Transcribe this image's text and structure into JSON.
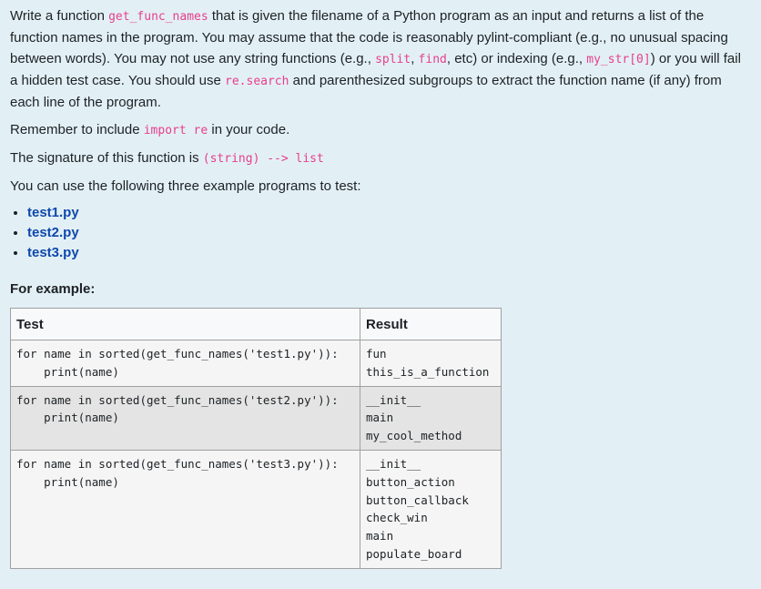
{
  "question": {
    "p1": {
      "t1": "Write a function ",
      "c1": "get_func_names",
      "t2": " that is given the filename of a Python program as an input and returns a list of the function names in the program. You may assume that the code is reasonably pylint-compliant (e.g., no unusual spacing between words).  You may not use any string functions (e.g., ",
      "c2": "split",
      "t3": ", ",
      "c3": "find",
      "t4": ", etc) or indexing (e.g., ",
      "c4": "my_str[0]",
      "t5": ") or you will fail a hidden test case. You should use ",
      "c5": "re.search",
      "t6": " and parenthesized subgroups to extract the function name (if any) from each line of the program."
    },
    "p2": {
      "t1": "Remember to include ",
      "c1": "import re",
      "t2": " in your code."
    },
    "p3": {
      "t1": "The signature of this function is ",
      "c1": "(string) --> list"
    },
    "p4": "You can use the following three example programs to test:",
    "files": [
      "test1.py",
      "test2.py",
      "test3.py"
    ],
    "for_example": "For example:"
  },
  "table": {
    "headers": {
      "test": "Test",
      "result": "Result"
    },
    "rows": [
      {
        "test": "for name in sorted(get_func_names('test1.py')):\n    print(name)",
        "result": "fun\nthis_is_a_function"
      },
      {
        "test": "for name in sorted(get_func_names('test2.py')):\n    print(name)",
        "result": "__init__\nmain\nmy_cool_method"
      },
      {
        "test": "for name in sorted(get_func_names('test3.py')):\n    print(name)",
        "result": "__init__\nbutton_action\nbutton_callback\ncheck_win\nmain\npopulate_board"
      }
    ]
  }
}
